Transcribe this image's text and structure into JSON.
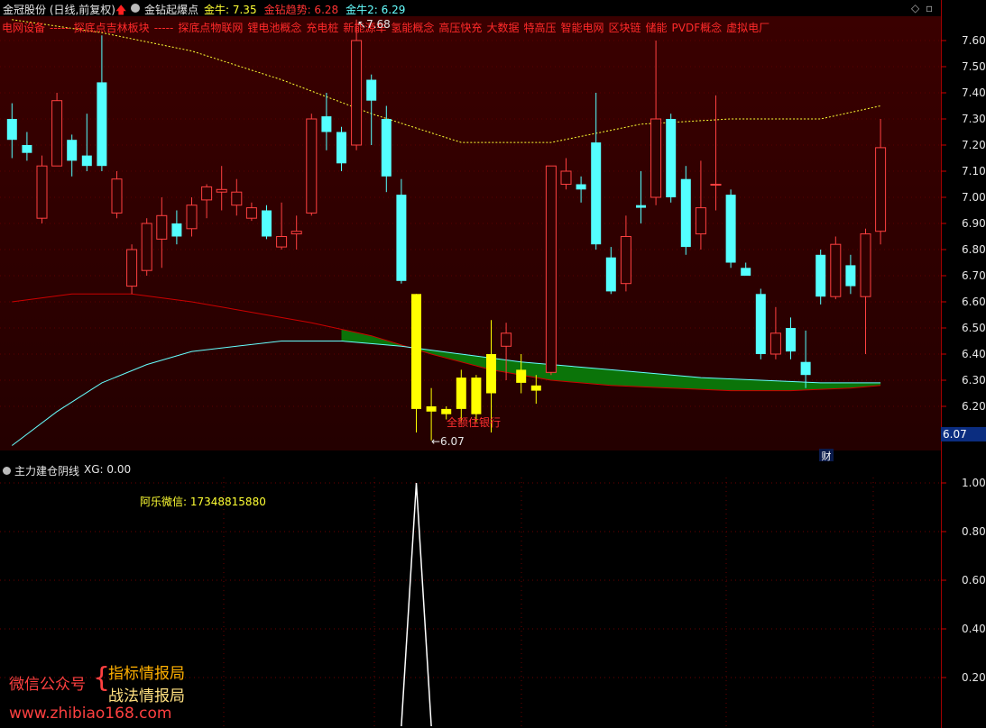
{
  "header": {
    "title": "金冠股份 (日线,前复权)",
    "indicator_name": "金钻起爆点",
    "items": [
      {
        "label": "金牛: 7.35",
        "color": "#ffff33"
      },
      {
        "label": "金钻趋势: 6.28",
        "color": "#ff3333"
      },
      {
        "label": "金牛2: 6.29",
        "color": "#66ffff"
      }
    ]
  },
  "concepts": [
    "电网设备",
    "-----",
    "探底点吉林板块",
    "-----",
    "探底点物联网",
    "锂电池概念",
    "充电桩",
    "新能源车",
    "氢能概念",
    "高压快充",
    "大数据",
    "特高压",
    "智能电网",
    "区块链",
    "储能",
    "PVDF概念",
    "虚拟电厂"
  ],
  "annotations": {
    "high_label": "7.68",
    "low_label": "←6.07",
    "stock_label": "全额住银行",
    "fin_marker": "财",
    "current_price": "6.07"
  },
  "indicator": {
    "title": "主力建仓阴线",
    "xg_label": "XG: 0.00",
    "note": "阿乐微信: 17348815880"
  },
  "watermark": {
    "left": "微信公众号",
    "line1": "指标情报局",
    "line2": "战法情报局",
    "url": "www.zhibiao168.com"
  },
  "chart_data": [
    {
      "type": "candlestick",
      "title": "金冠股份 (日线,前复权)",
      "y_ticks": [
        7.6,
        7.5,
        7.4,
        7.3,
        7.2,
        7.1,
        7.0,
        6.9,
        6.8,
        6.7,
        6.6,
        6.5,
        6.4,
        6.3,
        6.2
      ],
      "ylim": [
        6.05,
        7.72
      ],
      "candles": [
        [
          7.3,
          7.22,
          7.36,
          7.15
        ],
        [
          7.2,
          7.17,
          7.25,
          7.14
        ],
        [
          6.92,
          7.12,
          7.16,
          6.9
        ],
        [
          7.12,
          7.37,
          7.4,
          7.12
        ],
        [
          7.22,
          7.14,
          7.24,
          7.08
        ],
        [
          7.16,
          7.12,
          7.32,
          7.1
        ],
        [
          7.44,
          7.12,
          7.62,
          7.1
        ],
        [
          6.94,
          7.07,
          7.1,
          6.92
        ],
        [
          6.66,
          6.8,
          6.82,
          6.63
        ],
        [
          6.72,
          6.9,
          6.92,
          6.7
        ],
        [
          6.84,
          6.93,
          7.0,
          6.73
        ],
        [
          6.9,
          6.85,
          6.95,
          6.82
        ],
        [
          6.88,
          6.97,
          7.0,
          6.85
        ],
        [
          6.99,
          7.04,
          7.05,
          6.92
        ],
        [
          7.02,
          7.03,
          7.12,
          6.95
        ],
        [
          6.97,
          7.02,
          7.07,
          6.93
        ],
        [
          6.92,
          6.96,
          6.98,
          6.91
        ],
        [
          6.95,
          6.85,
          6.97,
          6.84
        ],
        [
          6.81,
          6.85,
          6.98,
          6.8
        ],
        [
          6.86,
          6.87,
          6.93,
          6.8
        ],
        [
          6.94,
          7.3,
          7.32,
          6.93
        ],
        [
          7.31,
          7.25,
          7.4,
          7.18
        ],
        [
          7.25,
          7.13,
          7.27,
          7.1
        ],
        [
          7.2,
          7.6,
          7.68,
          7.18
        ],
        [
          7.45,
          7.37,
          7.47,
          7.2
        ],
        [
          7.3,
          7.08,
          7.35,
          7.02
        ],
        [
          7.01,
          6.68,
          7.07,
          6.67
        ],
        [
          6.63,
          6.19,
          6.63,
          6.1
        ],
        [
          6.2,
          6.18,
          6.27,
          6.07
        ],
        [
          6.17,
          6.19,
          6.2,
          6.15
        ],
        [
          6.31,
          6.19,
          6.34,
          6.14
        ],
        [
          6.31,
          6.17,
          6.32,
          6.14
        ],
        [
          6.25,
          6.4,
          6.53,
          6.1
        ],
        [
          6.43,
          6.48,
          6.52,
          6.3
        ],
        [
          6.34,
          6.29,
          6.4,
          6.25
        ],
        [
          6.28,
          6.26,
          6.32,
          6.21
        ],
        [
          6.33,
          7.12,
          7.12,
          6.32
        ],
        [
          7.05,
          7.1,
          7.15,
          7.03
        ],
        [
          7.05,
          7.03,
          7.08,
          6.98
        ],
        [
          7.21,
          6.82,
          7.4,
          6.8
        ],
        [
          6.77,
          6.64,
          6.81,
          6.63
        ],
        [
          6.67,
          6.85,
          6.93,
          6.64
        ],
        [
          6.97,
          6.96,
          7.1,
          6.9
        ],
        [
          7.0,
          7.3,
          7.6,
          6.97
        ],
        [
          7.3,
          7.0,
          7.32,
          6.98
        ],
        [
          7.07,
          6.81,
          7.12,
          6.78
        ],
        [
          6.86,
          6.96,
          7.14,
          6.8
        ],
        [
          7.05,
          7.05,
          7.39,
          6.95
        ],
        [
          7.01,
          6.75,
          7.03,
          6.73
        ],
        [
          6.73,
          6.7,
          6.75,
          6.7
        ],
        [
          6.63,
          6.4,
          6.65,
          6.38
        ],
        [
          6.4,
          6.48,
          6.58,
          6.38
        ],
        [
          6.5,
          6.41,
          6.54,
          6.38
        ],
        [
          6.37,
          6.32,
          6.49,
          6.27
        ],
        [
          6.78,
          6.62,
          6.8,
          6.59
        ],
        [
          6.62,
          6.82,
          6.85,
          6.61
        ],
        [
          6.74,
          6.66,
          6.78,
          6.63
        ],
        [
          6.62,
          6.86,
          6.88,
          6.4
        ],
        [
          6.87,
          7.19,
          7.3,
          6.82
        ]
      ],
      "gold_candle_indices": [
        27,
        28,
        29,
        30,
        31,
        32,
        34,
        35
      ],
      "series": [
        {
          "name": "金牛",
          "color": "#ffff33",
          "style": "dotted",
          "x": [
            0,
            6,
            12,
            18,
            24,
            30,
            36,
            42,
            48,
            54,
            58
          ],
          "values": [
            7.68,
            7.63,
            7.56,
            7.45,
            7.32,
            7.21,
            7.21,
            7.28,
            7.3,
            7.3,
            7.35
          ]
        },
        {
          "name": "金钻趋势",
          "color": "#cc0000",
          "style": "solid",
          "x": [
            0,
            4,
            8,
            12,
            16,
            20,
            24,
            28,
            32,
            36,
            40,
            44,
            48,
            52,
            56,
            58
          ],
          "values": [
            6.6,
            6.63,
            6.63,
            6.6,
            6.56,
            6.52,
            6.47,
            6.4,
            6.34,
            6.3,
            6.28,
            6.27,
            6.26,
            6.26,
            6.27,
            6.28
          ]
        },
        {
          "name": "金牛2",
          "color": "#66ffff",
          "style": "solid",
          "x": [
            0,
            3,
            6,
            9,
            12,
            15,
            18,
            21,
            22,
            26,
            30,
            34,
            38,
            42,
            46,
            50,
            54,
            58
          ],
          "values": [
            6.05,
            6.18,
            6.29,
            6.36,
            6.41,
            6.43,
            6.45,
            6.45,
            6.45,
            6.43,
            6.4,
            6.37,
            6.35,
            6.33,
            6.31,
            6.3,
            6.29,
            6.29
          ]
        }
      ]
    },
    {
      "type": "line",
      "title": "主力建仓阴线",
      "y_ticks": [
        1.0,
        0.8,
        0.6,
        0.4,
        0.2
      ],
      "ylim": [
        0,
        1.0
      ],
      "x": [
        26,
        27,
        28
      ],
      "values": [
        0,
        1,
        0
      ]
    }
  ]
}
